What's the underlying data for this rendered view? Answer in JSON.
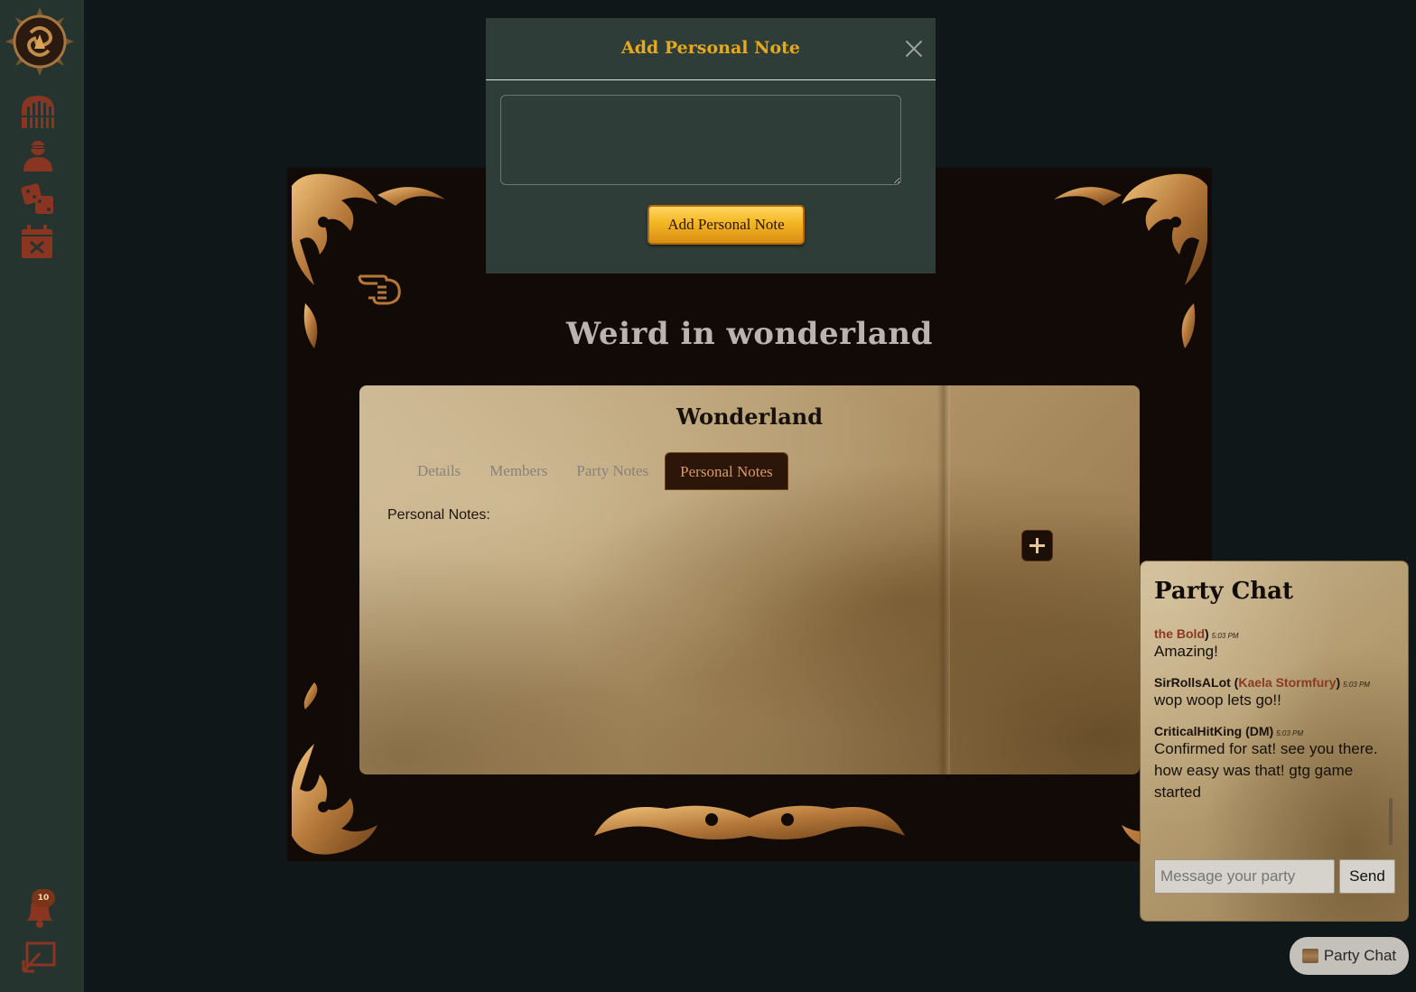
{
  "sidebar": {
    "nav": [
      "campaigns-icon",
      "character-icon",
      "dice-icon",
      "calendar-cancel-icon"
    ],
    "notifications": {
      "count": "10"
    },
    "accent": "#8a3422"
  },
  "page": {
    "title": "Weird in wonderland"
  },
  "campaign": {
    "name": "Wonderland",
    "tabs": [
      {
        "label": "Details"
      },
      {
        "label": "Members"
      },
      {
        "label": "Party Notes"
      },
      {
        "label": "Personal Notes"
      }
    ],
    "active_tab": "Personal Notes",
    "notes_label": "Personal Notes:"
  },
  "modal": {
    "title": "Add Personal Note",
    "textarea_value": "",
    "submit_label": "Add Personal Note"
  },
  "chat": {
    "title": "Party Chat",
    "messages": [
      {
        "user": "",
        "character": "the Bold",
        "time": "5:03 PM",
        "text": "Amazing!"
      },
      {
        "user": "SirRollsALot",
        "character": "Kaela Stormfury",
        "time": "5:03 PM",
        "text": "wop woop lets go!!"
      },
      {
        "user": "CriticalHitKing (DM)",
        "character": "",
        "time": "5:03 PM",
        "text": "Confirmed for sat! see you there. how easy was that! gtg game started"
      }
    ],
    "input_placeholder": "Message your party",
    "send_label": "Send",
    "toggle_label": "Party Chat"
  }
}
